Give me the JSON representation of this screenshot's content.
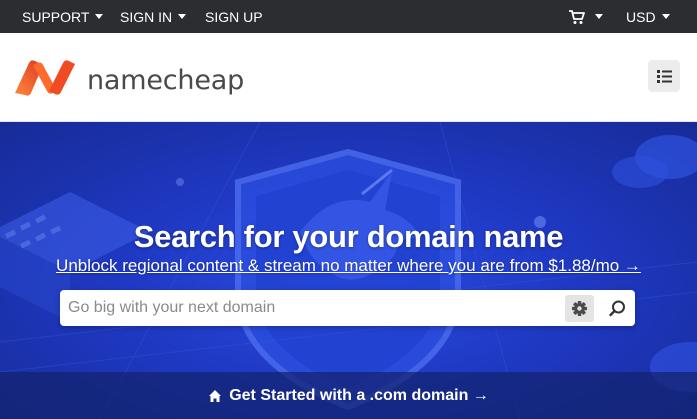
{
  "topbar": {
    "support": "SUPPORT",
    "sign_in": "SIGN IN",
    "sign_up": "SIGN UP",
    "currency": "USD",
    "cart_icon": "cart-icon"
  },
  "header": {
    "brand": "namecheap",
    "brand_colors": {
      "orange_light": "#ff8a3c",
      "orange_dark": "#de3723"
    },
    "menu_icon": "list-icon"
  },
  "hero": {
    "title": "Search for your domain name",
    "promo_link": "Unblock regional content & stream no matter where you are from $1.88/mo →",
    "search": {
      "placeholder": "Go big with your next domain",
      "value": "",
      "settings_icon": "gear-icon",
      "submit_icon": "search-icon"
    },
    "cta": "Get Started with a .com domain →",
    "cta_icon": "home-icon",
    "background_color": "#1f39c4"
  }
}
